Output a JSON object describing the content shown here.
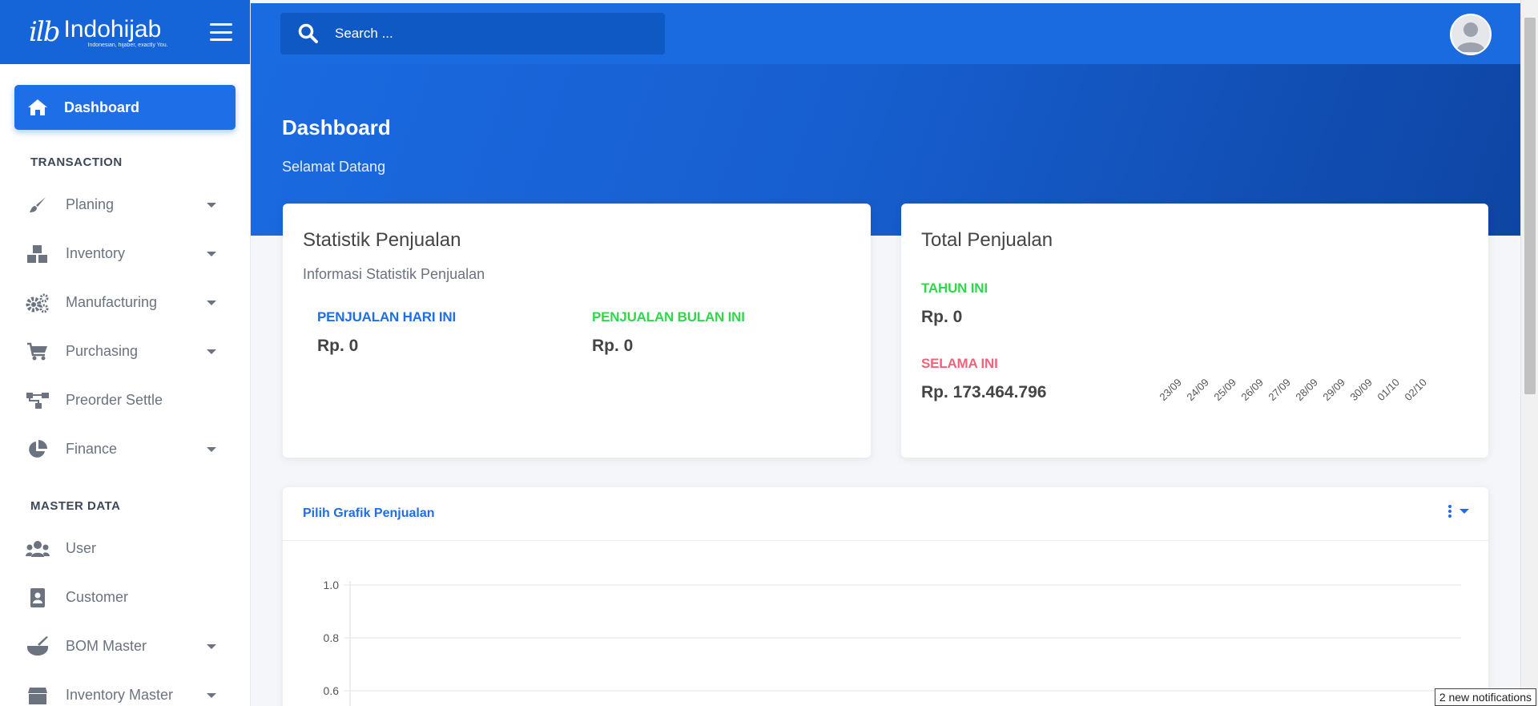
{
  "brand": {
    "logo_mark": "ilb",
    "name": "Indohijab",
    "tagline": "Indonesian, hijaber, exactly You."
  },
  "search": {
    "placeholder": "Search ..."
  },
  "sidebar": {
    "active": {
      "label": "Dashboard",
      "icon": "home-icon"
    },
    "sections": [
      {
        "title": "TRANSACTION",
        "items": [
          {
            "label": "Planing",
            "icon": "brush-icon",
            "has_caret": true
          },
          {
            "label": "Inventory",
            "icon": "boxes-icon",
            "has_caret": true
          },
          {
            "label": "Manufacturing",
            "icon": "gears-icon",
            "has_caret": true
          },
          {
            "label": "Purchasing",
            "icon": "cart-icon",
            "has_caret": true
          },
          {
            "label": "Preorder Settle",
            "icon": "sitemap-icon",
            "has_caret": false
          },
          {
            "label": "Finance",
            "icon": "pie-chart-icon",
            "has_caret": true
          }
        ]
      },
      {
        "title": "MASTER DATA",
        "items": [
          {
            "label": "User",
            "icon": "users-icon",
            "has_caret": false
          },
          {
            "label": "Customer",
            "icon": "address-book-icon",
            "has_caret": false
          },
          {
            "label": "BOM Master",
            "icon": "mortar-pestle-icon",
            "has_caret": true
          },
          {
            "label": "Inventory Master",
            "icon": "box-icon",
            "has_caret": true
          }
        ]
      }
    ]
  },
  "header": {
    "title": "Dashboard",
    "subtitle": "Selamat Datang"
  },
  "stat_card": {
    "title": "Statistik Penjualan",
    "subtitle": "Informasi Statistik Penjualan",
    "today_label": "PENJUALAN HARI INI",
    "today_value": "Rp. 0",
    "month_label": "PENJUALAN BULAN INI",
    "month_value": "Rp. 0"
  },
  "total_card": {
    "title": "Total Penjualan",
    "year_label": "TAHUN INI",
    "year_value": "Rp. 0",
    "alltime_label": "SELAMA INI",
    "alltime_value": "Rp. 173.464.796",
    "dates": [
      "23/09",
      "24/09",
      "25/09",
      "26/09",
      "27/09",
      "28/09",
      "29/09",
      "30/09",
      "01/10",
      "02/10"
    ]
  },
  "chart_card": {
    "title": "Pilih Grafik Penjualan"
  },
  "chart_data": {
    "type": "line",
    "title": "",
    "xlabel": "",
    "ylabel": "",
    "y_ticks": [
      "1.0",
      "0.8",
      "0.6"
    ],
    "ylim": [
      0,
      1
    ],
    "grid": true,
    "series": []
  },
  "notification": {
    "text": "2 new notifications"
  },
  "colors": {
    "primary": "#1a6ae0",
    "header_dark": "#0e45a3",
    "green": "#2ed84a",
    "red": "#f0627a"
  }
}
